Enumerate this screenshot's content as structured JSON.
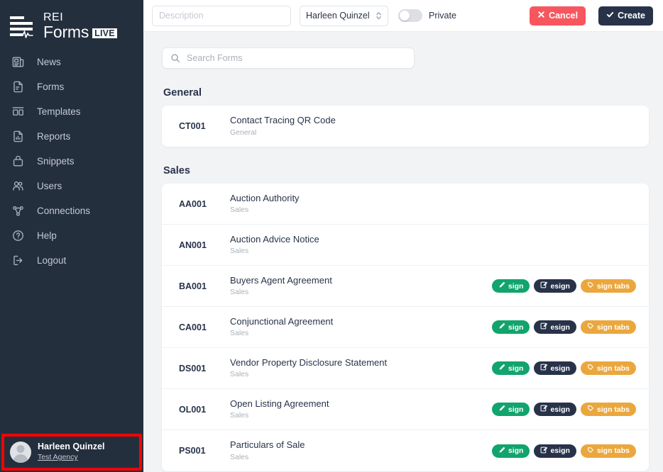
{
  "brand": {
    "rei": "REI",
    "forms": "Forms",
    "live": "LIVE"
  },
  "sidebar": {
    "items": [
      {
        "label": "News",
        "icon": "news-icon"
      },
      {
        "label": "Forms",
        "icon": "forms-icon"
      },
      {
        "label": "Templates",
        "icon": "templates-icon"
      },
      {
        "label": "Reports",
        "icon": "reports-icon"
      },
      {
        "label": "Snippets",
        "icon": "snippets-icon"
      },
      {
        "label": "Users",
        "icon": "users-icon"
      },
      {
        "label": "Connections",
        "icon": "connections-icon"
      },
      {
        "label": "Help",
        "icon": "help-icon"
      },
      {
        "label": "Logout",
        "icon": "logout-icon"
      }
    ],
    "profile": {
      "name": "Harleen Quinzel",
      "agency": "Test Agency"
    },
    "highlight_color": "#ff0000",
    "background": "#242f3e"
  },
  "topbar": {
    "description_placeholder": "Description",
    "description_value": "",
    "owner_select_value": "Harleen Quinzel",
    "private_toggle_label": "Private",
    "private_toggle_on": false,
    "cancel_label": "Cancel",
    "create_label": "Create",
    "cancel_color": "#f8565f",
    "create_color": "#28334a"
  },
  "search": {
    "placeholder": "Search Forms",
    "value": ""
  },
  "groups": [
    {
      "title": "General",
      "rows": [
        {
          "code": "CT001",
          "title": "Contact Tracing QR Code",
          "subtitle": "General",
          "badges": []
        }
      ]
    },
    {
      "title": "Sales",
      "rows": [
        {
          "code": "AA001",
          "title": "Auction Authority",
          "subtitle": "Sales",
          "badges": []
        },
        {
          "code": "AN001",
          "title": "Auction Advice Notice",
          "subtitle": "Sales",
          "badges": []
        },
        {
          "code": "BA001",
          "title": "Buyers Agent Agreement",
          "subtitle": "Sales",
          "badges": [
            "sign",
            "esign",
            "sign tabs"
          ]
        },
        {
          "code": "CA001",
          "title": "Conjunctional Agreement",
          "subtitle": "Sales",
          "badges": [
            "sign",
            "esign",
            "sign tabs"
          ]
        },
        {
          "code": "DS001",
          "title": "Vendor Property Disclosure Statement",
          "subtitle": "Sales",
          "badges": [
            "sign",
            "esign",
            "sign tabs"
          ]
        },
        {
          "code": "OL001",
          "title": "Open Listing Agreement",
          "subtitle": "Sales",
          "badges": [
            "sign",
            "esign",
            "sign tabs"
          ]
        },
        {
          "code": "PS001",
          "title": "Particulars of Sale",
          "subtitle": "Sales",
          "badges": [
            "sign",
            "esign",
            "sign tabs"
          ]
        }
      ]
    }
  ],
  "badge_colors": {
    "sign": "#11a46d",
    "esign": "#28334a",
    "sign tabs": "#eba73d"
  }
}
